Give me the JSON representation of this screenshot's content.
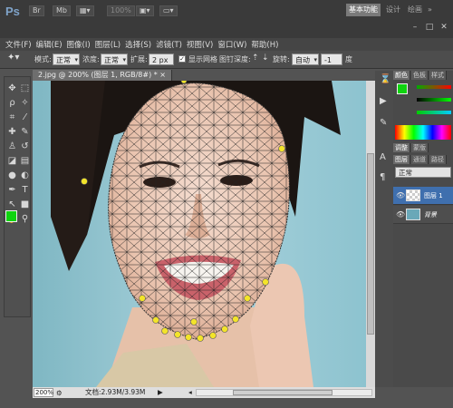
{
  "app": {
    "logo": "Ps",
    "zoom_display": "100%",
    "workspace_active": "基本功能",
    "workspaces": [
      "设计",
      "绘画"
    ],
    "more": "»",
    "window_controls": [
      "–",
      "□",
      "✕"
    ]
  },
  "menu": [
    "文件(F)",
    "编辑(E)",
    "图像(I)",
    "图层(L)",
    "选择(S)",
    "滤镜(T)",
    "视图(V)",
    "窗口(W)",
    "帮助(H)"
  ],
  "options": {
    "mode_label": "模式:",
    "mode_value": "正常",
    "density_label": "浓度:",
    "density_value": "正常",
    "expansion_label": "扩展:",
    "expansion_value": "2 px",
    "show_mesh_label": "显示网格",
    "pin_depth_label": "图钉深度:",
    "rotation_label": "旋转:",
    "rotation_value": "自动",
    "angle_value": "-1",
    "angle_unit": "度"
  },
  "document": {
    "tab_title": "2.jpg @ 200% (图层 1, RGB/8#) * ×",
    "zoom": "200%",
    "info": "文档:2.93M/3.93M",
    "arrow": "▶"
  },
  "tools": [
    {
      "icon": "move-icon",
      "glyph": "✥"
    },
    {
      "icon": "marquee-icon",
      "glyph": "⬚"
    },
    {
      "icon": "lasso-icon",
      "glyph": "ρ"
    },
    {
      "icon": "magic-wand-icon",
      "glyph": "✧"
    },
    {
      "icon": "crop-icon",
      "glyph": "⌗"
    },
    {
      "icon": "eyedropper-icon",
      "glyph": "⁄"
    },
    {
      "icon": "healing-icon",
      "glyph": "✚"
    },
    {
      "icon": "brush-icon",
      "glyph": "✎"
    },
    {
      "icon": "stamp-icon",
      "glyph": "♙"
    },
    {
      "icon": "history-brush-icon",
      "glyph": "↺"
    },
    {
      "icon": "eraser-icon",
      "glyph": "◪"
    },
    {
      "icon": "gradient-icon",
      "glyph": "▤"
    },
    {
      "icon": "blur-icon",
      "glyph": "●"
    },
    {
      "icon": "dodge-icon",
      "glyph": "◐"
    },
    {
      "icon": "pen-icon",
      "glyph": "✒"
    },
    {
      "icon": "type-icon",
      "glyph": "T"
    },
    {
      "icon": "path-select-icon",
      "glyph": "↖"
    },
    {
      "icon": "shape-icon",
      "glyph": "■"
    },
    {
      "icon": "hand-icon",
      "glyph": "✋"
    },
    {
      "icon": "zoom-icon",
      "glyph": "⚲"
    }
  ],
  "colors": {
    "foreground": "#0fd40f",
    "background": "#e00010"
  },
  "panels": {
    "color_tabs": [
      "颜色",
      "色板",
      "样式"
    ],
    "adjust_tabs": [
      "调整",
      "蒙版"
    ],
    "layer_tabs": [
      "图层",
      "通道",
      "路径"
    ],
    "blend_mode": "正常",
    "layers": [
      {
        "name": "图层 1",
        "selected": true
      },
      {
        "name": "背景",
        "selected": false
      }
    ]
  }
}
